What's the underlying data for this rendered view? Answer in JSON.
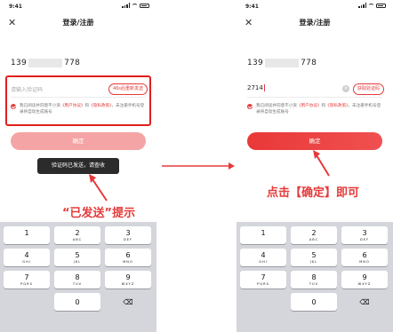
{
  "left": {
    "status_time": "9:41",
    "title": "登录/注册",
    "phone_prefix": "139",
    "phone_suffix": "778",
    "code_placeholder": "请输入验证码",
    "sms_button": "46s后重新发送",
    "agreement": [
      "我已阅读并同意不小资",
      "《用户协议》",
      "和",
      "《隐私政策》",
      "，未注册手机号登录将自动生成账号"
    ],
    "confirm": "确定",
    "toast": "验证码已发送，请查收",
    "annotation": "“已发送”提示"
  },
  "right": {
    "status_time": "9:41",
    "title": "登录/注册",
    "phone_prefix": "139",
    "phone_suffix": "778",
    "code_value": "2714",
    "sms_button": "获取验证码",
    "agreement": [
      "我已阅读并同意不小资",
      "《用户协议》",
      "和",
      "《隐私政策》",
      "，未注册手机号登录将自动生成账号"
    ],
    "confirm": "确定",
    "annotation": "点击【确定】即可"
  },
  "keypad": [
    {
      "num": "1",
      "sub": ""
    },
    {
      "num": "2",
      "sub": "ABC"
    },
    {
      "num": "3",
      "sub": "DEF"
    },
    {
      "num": "4",
      "sub": "GHI"
    },
    {
      "num": "5",
      "sub": "JKL"
    },
    {
      "num": "6",
      "sub": "MNO"
    },
    {
      "num": "7",
      "sub": "PQRS"
    },
    {
      "num": "8",
      "sub": "TUV"
    },
    {
      "num": "9",
      "sub": "WXYZ"
    },
    {
      "num": "",
      "sub": ""
    },
    {
      "num": "0",
      "sub": ""
    },
    {
      "num": "⌫",
      "sub": ""
    }
  ],
  "colors": {
    "accent": "#e53a3a",
    "highlight": "#e01e1e",
    "toast": "#2b2b2b",
    "keyboard_bg": "#d4d6dc"
  },
  "icons": {
    "close": "close-icon",
    "delete": "backspace-icon",
    "check": "check-icon"
  }
}
